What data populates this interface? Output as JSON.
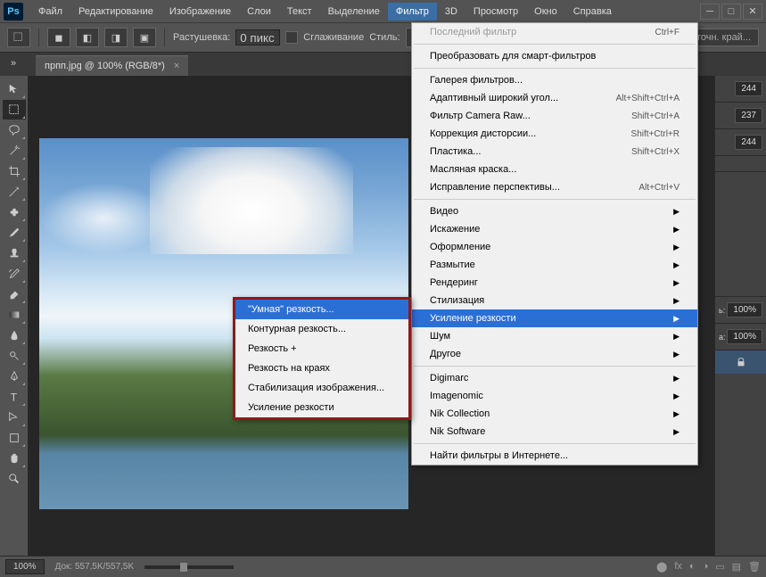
{
  "app": {
    "logo": "Ps"
  },
  "menu": {
    "items": [
      "Файл",
      "Редактирование",
      "Изображение",
      "Слои",
      "Текст",
      "Выделение",
      "Фильтр",
      "3D",
      "Просмотр",
      "Окно",
      "Справка"
    ],
    "active": 6
  },
  "options": {
    "feather_label": "Растушевка:",
    "feather_value": "0 пикс.",
    "antialias": "Сглаживание",
    "style_label": "Стиль:",
    "refine": "Уточн. край..."
  },
  "tab": {
    "title": "прпп.jpg @ 100% (RGB/8*)"
  },
  "right": {
    "v1": "244",
    "v2": "237",
    "v3": "244",
    "opacity_label": "ь:",
    "opacity": "100%",
    "fill_label": "а:",
    "fill": "100%"
  },
  "status": {
    "zoom": "100%",
    "doc_label": "Док:",
    "doc_size": "557,5K/557,5K"
  },
  "filter_menu": {
    "last": "Последний фильтр",
    "last_sc": "Ctrl+F",
    "convert": "Преобразовать для смарт-фильтров",
    "gallery": "Галерея фильтров...",
    "adaptive": "Адаптивный широкий угол...",
    "adaptive_sc": "Alt+Shift+Ctrl+A",
    "cameraraw": "Фильтр Camera Raw...",
    "cameraraw_sc": "Shift+Ctrl+A",
    "lens": "Коррекция дисторсии...",
    "lens_sc": "Shift+Ctrl+R",
    "plastic": "Пластика...",
    "plastic_sc": "Shift+Ctrl+X",
    "oil": "Масляная краска...",
    "persp": "Исправление перспективы...",
    "persp_sc": "Alt+Ctrl+V",
    "video": "Видео",
    "distort": "Искажение",
    "render_design": "Оформление",
    "blur": "Размытие",
    "render": "Рендеринг",
    "stylize": "Стилизация",
    "sharpen": "Усиление резкости",
    "noise": "Шум",
    "other": "Другое",
    "digimarc": "Digimarc",
    "imagenomic": "Imagenomic",
    "nikcol": "Nik Collection",
    "niksoft": "Nik Software",
    "online": "Найти фильтры в Интернете..."
  },
  "sharpen_sub": {
    "smart": "\"Умная\" резкость...",
    "contour": "Контурная резкость...",
    "sharpen_plus": "Резкость +",
    "edges": "Резкость на краях",
    "stabilize": "Стабилизация изображения...",
    "sharpen": "Усиление резкости"
  }
}
